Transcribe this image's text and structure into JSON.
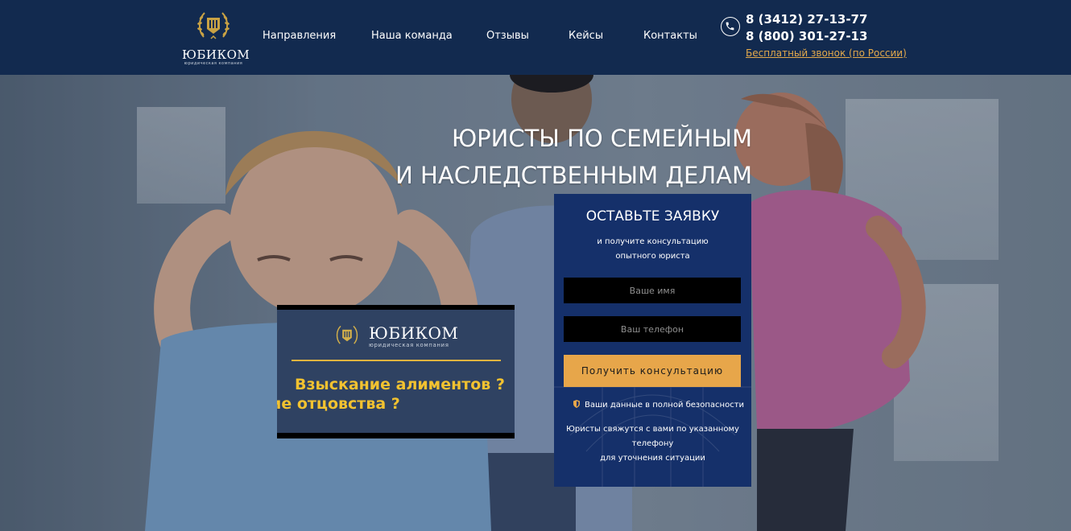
{
  "header": {
    "logo": {
      "name": "ЮБИКОМ",
      "subtitle": "юридическая компания"
    },
    "nav": [
      {
        "label": "Направления"
      },
      {
        "label": "Наша команда"
      },
      {
        "label": "Отзывы"
      },
      {
        "label": "Кейсы"
      },
      {
        "label": "Контакты"
      }
    ],
    "phones": [
      "8 (3412) 27-13-77",
      "8 (800) 301-27-13"
    ],
    "free_call_label": "Бесплатный звонок (по России)",
    "icon": "phone-icon"
  },
  "hero": {
    "title_line1": "ЮРИСТЫ ПО СЕМЕЙНЫМ",
    "title_line2": "И НАСЛЕДСТВЕННЫМ ДЕЛАМ"
  },
  "form": {
    "title": "ОСТАВЬТЕ ЗАЯВКУ",
    "subtitle_line1": "и получите консультацию",
    "subtitle_line2": "опытного юриста",
    "name_placeholder": "Ваше имя",
    "phone_placeholder": "Ваш телефон",
    "submit_label": "Получить консультацию",
    "secure_text": "Ваши данные в полной безопасности",
    "callback_line1": "Юристы свяжутся с вами по указанному",
    "callback_line2": "телефону",
    "callback_line3": "для уточнения ситуации"
  },
  "banner": {
    "logo_name": "ЮБИКОМ",
    "logo_subtitle": "юридическая компания",
    "text_line1": "Взыскание алиментов ?",
    "text_line2": "ие отцовства ?"
  },
  "colors": {
    "header_bg": "#122a4f",
    "accent_orange": "#e7a64a",
    "form_bg": "#15306a",
    "banner_text": "#f2c230"
  }
}
